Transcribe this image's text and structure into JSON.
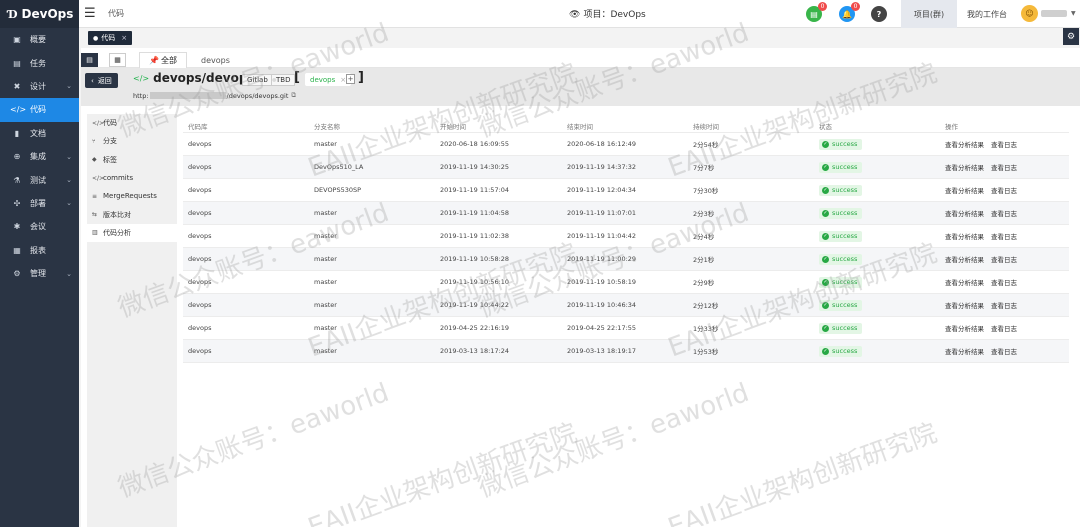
{
  "brand": {
    "logo": "Ɗ",
    "name": "DevOps"
  },
  "sidebar": {
    "items": [
      {
        "icon": "▣",
        "label": "概要",
        "chevron": false,
        "active": false
      },
      {
        "icon": "▤",
        "label": "任务",
        "chevron": false,
        "active": false
      },
      {
        "icon": "✖",
        "label": "设计",
        "chevron": true,
        "active": false
      },
      {
        "icon": "</>",
        "label": "代码",
        "chevron": false,
        "active": true
      },
      {
        "icon": "▮",
        "label": "文档",
        "chevron": false,
        "active": false
      },
      {
        "icon": "⊕",
        "label": "集成",
        "chevron": true,
        "active": false
      },
      {
        "icon": "⚗",
        "label": "测试",
        "chevron": true,
        "active": false
      },
      {
        "icon": "✣",
        "label": "部署",
        "chevron": true,
        "active": false
      },
      {
        "icon": "✱",
        "label": "会议",
        "chevron": false,
        "active": false
      },
      {
        "icon": "▦",
        "label": "报表",
        "chevron": false,
        "active": false
      },
      {
        "icon": "⚙",
        "label": "管理",
        "chevron": true,
        "active": false
      }
    ]
  },
  "topbar": {
    "breadcrumb": "代码",
    "project_label": "项目：DevOps",
    "notif_doc_badge": "0",
    "notif_bell_badge": "0",
    "help": "?",
    "project_switch": "项目(群)",
    "workbench": "我的工作台"
  },
  "opentabs": [
    {
      "label": "代码",
      "close": "×"
    }
  ],
  "subtabs": {
    "all": "全部",
    "repo": "devops"
  },
  "repo": {
    "back": "返回",
    "name": "devops/devops",
    "tags": [
      "Gitlab",
      "TBD"
    ],
    "branch": "devops",
    "branch_close": "×",
    "add": "+",
    "url_prefix": "http:",
    "url_suffix": "/devops/devops.git"
  },
  "submenu": [
    {
      "icon": "</>",
      "label": "代码",
      "active": false
    },
    {
      "icon": "⑂",
      "label": "分支",
      "active": false
    },
    {
      "icon": "◆",
      "label": "标签",
      "active": false
    },
    {
      "icon": "</>",
      "label": "commits",
      "active": false
    },
    {
      "icon": "≡",
      "label": "MergeRequests",
      "active": false
    },
    {
      "icon": "⇆",
      "label": "版本比对",
      "active": false
    },
    {
      "icon": "▥",
      "label": "代码分析",
      "active": true
    }
  ],
  "table": {
    "headers": [
      "代码库",
      "分支名称",
      "开始时间",
      "结束时间",
      "持续时间",
      "状态",
      "操作"
    ],
    "action_labels": [
      "查看分析结果",
      "查看日志"
    ],
    "rows": [
      {
        "repo": "devops",
        "branch": "master",
        "start": "2020-06-18 16:09:55",
        "end": "2020-06-18 16:12:49",
        "duration": "2分54秒",
        "status": "success"
      },
      {
        "repo": "devops",
        "branch": "DevOps510_LA",
        "start": "2019-11-19 14:30:25",
        "end": "2019-11-19 14:37:32",
        "duration": "7分7秒",
        "status": "success"
      },
      {
        "repo": "devops",
        "branch": "DEVOPS530SP",
        "start": "2019-11-19 11:57:04",
        "end": "2019-11-19 12:04:34",
        "duration": "7分30秒",
        "status": "success"
      },
      {
        "repo": "devops",
        "branch": "master",
        "start": "2019-11-19 11:04:58",
        "end": "2019-11-19 11:07:01",
        "duration": "2分3秒",
        "status": "success"
      },
      {
        "repo": "devops",
        "branch": "master",
        "start": "2019-11-19 11:02:38",
        "end": "2019-11-19 11:04:42",
        "duration": "2分4秒",
        "status": "success"
      },
      {
        "repo": "devops",
        "branch": "master",
        "start": "2019-11-19 10:58:28",
        "end": "2019-11-19 11:00:29",
        "duration": "2分1秒",
        "status": "success"
      },
      {
        "repo": "devops",
        "branch": "master",
        "start": "2019-11-19 10:56:10",
        "end": "2019-11-19 10:58:19",
        "duration": "2分9秒",
        "status": "success"
      },
      {
        "repo": "devops",
        "branch": "master",
        "start": "2019-11-19 10:44:22",
        "end": "2019-11-19 10:46:34",
        "duration": "2分12秒",
        "status": "success"
      },
      {
        "repo": "devops",
        "branch": "master",
        "start": "2019-04-25 22:16:19",
        "end": "2019-04-25 22:17:55",
        "duration": "1分33秒",
        "status": "success"
      },
      {
        "repo": "devops",
        "branch": "master",
        "start": "2019-03-13 18:17:24",
        "end": "2019-03-13 18:19:17",
        "duration": "1分53秒",
        "status": "success"
      }
    ]
  },
  "watermark": {
    "line1": "EAII企业架构创新研究院",
    "line2": "微信公众账号：eaworld"
  },
  "colors": {
    "sidebar": "#2a3444",
    "accent": "#1e88e5",
    "success": "#27a844",
    "badge": "#f04b4b"
  }
}
